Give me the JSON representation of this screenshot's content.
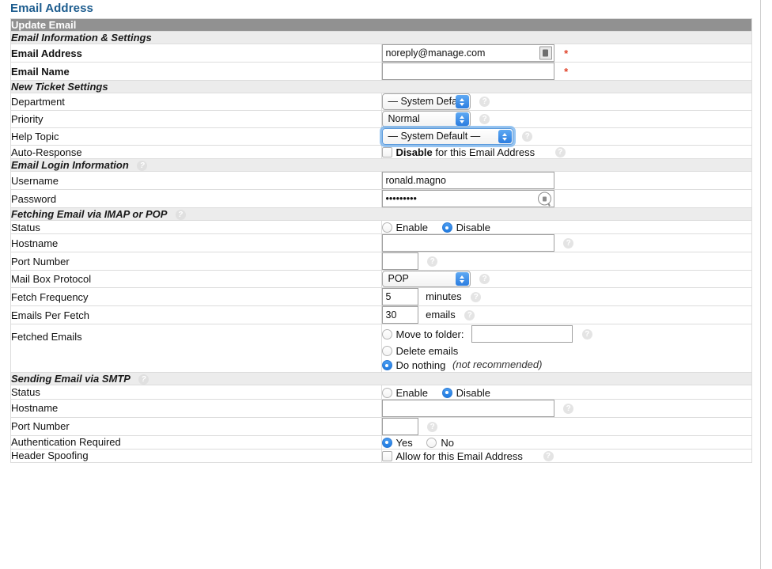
{
  "page": {
    "title": "Email Address"
  },
  "panel": {
    "main_header": "Update Email",
    "sections": {
      "info": "Email Information & Settings",
      "ticket": "New Ticket Settings",
      "login": "Email Login Information",
      "fetch": "Fetching Email via IMAP or POP",
      "smtp": "Sending Email via SMTP"
    }
  },
  "fields": {
    "email_address": {
      "label": "Email Address",
      "value": "noreply@manage.com",
      "required": "*"
    },
    "email_name": {
      "label": "Email Name",
      "value": "",
      "required": "*"
    },
    "department": {
      "label": "Department",
      "value": "— System Default —"
    },
    "priority": {
      "label": "Priority",
      "value": "Normal"
    },
    "help_topic": {
      "label": "Help Topic",
      "value": "— System Default —"
    },
    "auto_response": {
      "label": "Auto-Response",
      "text_bold": "Disable",
      "text_rest": " for this Email Address",
      "checked": false
    },
    "username": {
      "label": "Username",
      "value": "ronald.magno"
    },
    "password": {
      "label": "Password",
      "value": "•••••••••"
    },
    "fetch_status": {
      "label": "Status",
      "enable": "Enable",
      "disable": "Disable",
      "selected": "Disable"
    },
    "fetch_hostname": {
      "label": "Hostname",
      "value": ""
    },
    "fetch_port": {
      "label": "Port Number",
      "value": ""
    },
    "mailbox_protocol": {
      "label": "Mail Box Protocol",
      "value": "POP"
    },
    "fetch_frequency": {
      "label": "Fetch Frequency",
      "value": "5",
      "unit": "minutes"
    },
    "emails_per_fetch": {
      "label": "Emails Per Fetch",
      "value": "30",
      "unit": "emails"
    },
    "fetched_emails": {
      "label": "Fetched Emails",
      "opt_move": "Move to folder:",
      "move_value": "",
      "opt_delete": "Delete emails",
      "opt_nothing": "Do nothing",
      "opt_nothing_note": "(not recommended)",
      "selected": "Do nothing"
    },
    "smtp_status": {
      "label": "Status",
      "enable": "Enable",
      "disable": "Disable",
      "selected": "Disable"
    },
    "smtp_hostname": {
      "label": "Hostname",
      "value": ""
    },
    "smtp_port": {
      "label": "Port Number",
      "value": ""
    },
    "auth_required": {
      "label": "Authentication Required",
      "yes": "Yes",
      "no": "No",
      "selected": "Yes"
    },
    "header_spoofing": {
      "label": "Header Spoofing",
      "text": "Allow for this Email Address",
      "checked": false
    }
  },
  "icons": {
    "help": "?",
    "autofill": "contact-card-icon",
    "password_reveal": "key-icon"
  },
  "colors": {
    "title": "#1c5c8e",
    "header_bar": "#919191",
    "section_bar": "#ececec",
    "accent_blue": "#2b7de0",
    "required": "#e0432a"
  }
}
